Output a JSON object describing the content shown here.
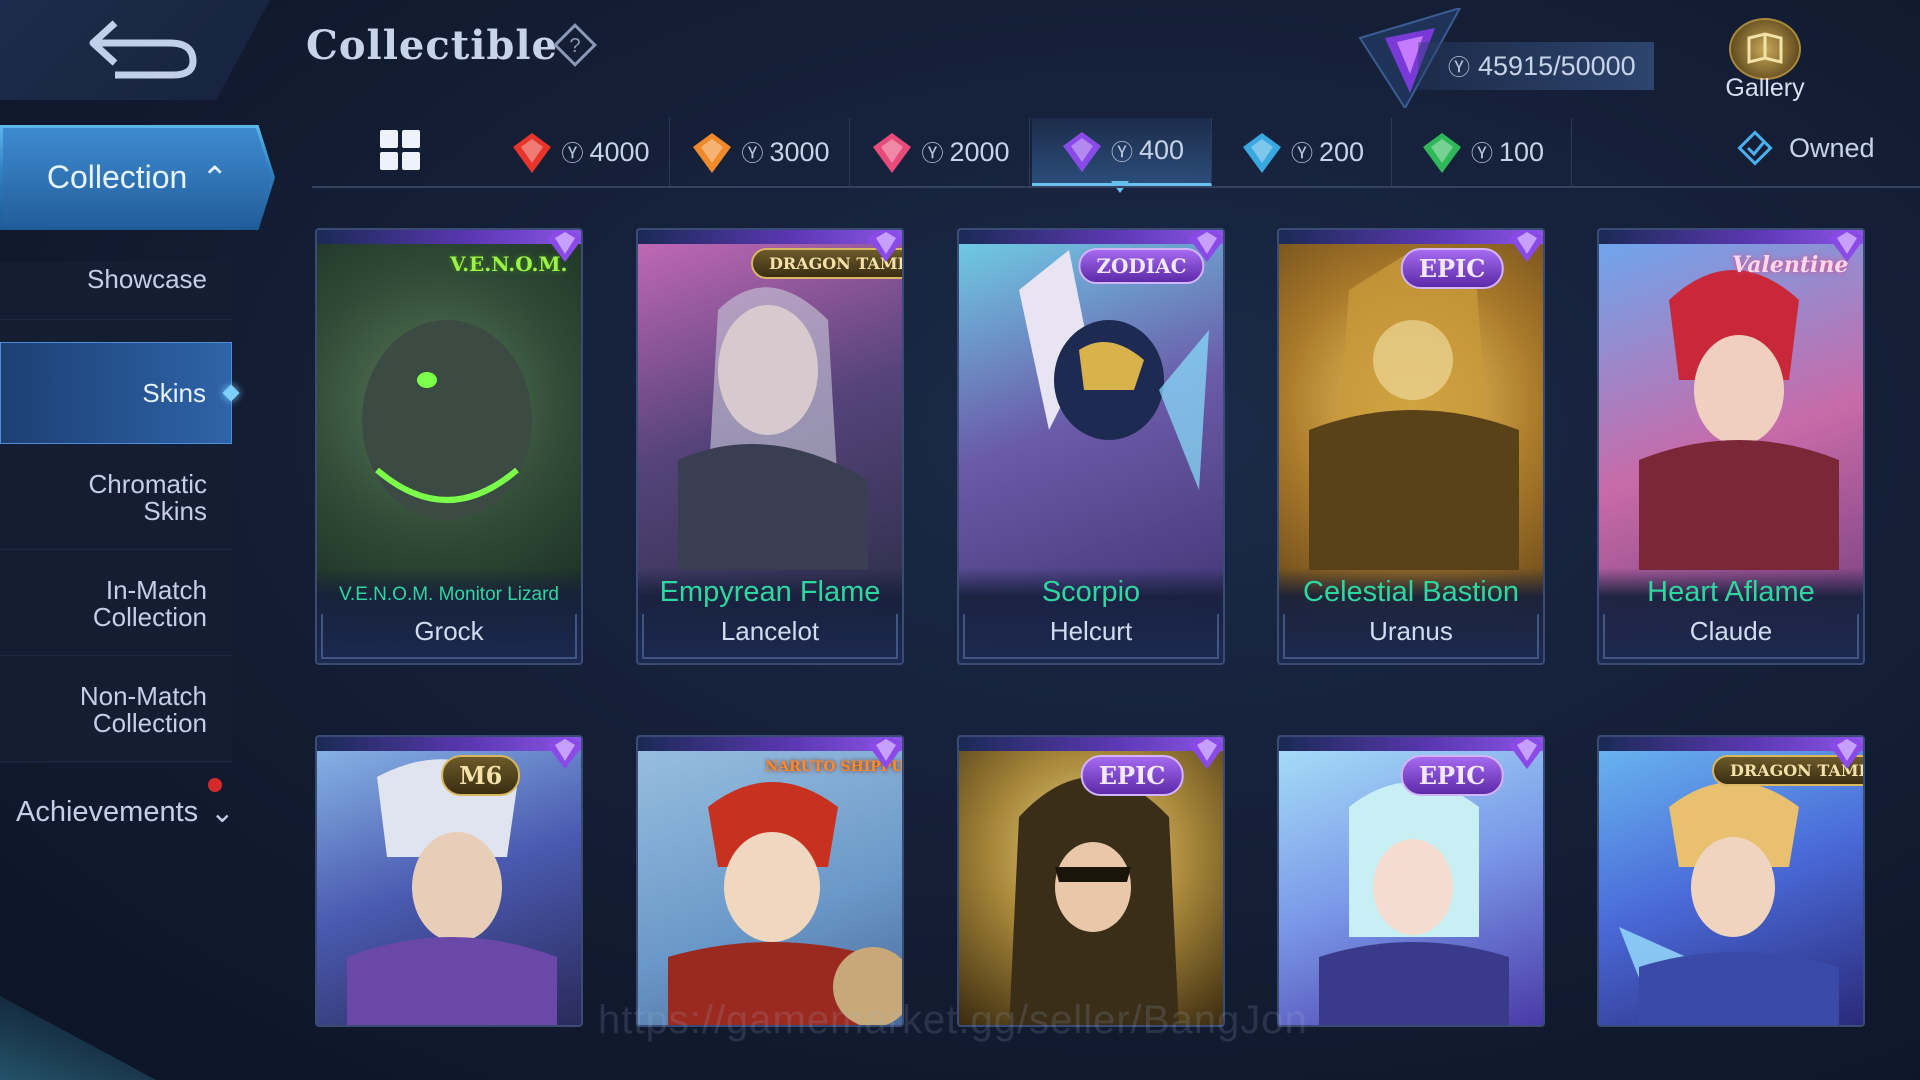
{
  "header": {
    "title": "Collectible",
    "currency": "45915/50000",
    "gallery_label": "Gallery"
  },
  "sidebar": {
    "collection_label": "Collection",
    "items": [
      {
        "label": "Showcase"
      },
      {
        "label": "Skins"
      },
      {
        "label": "Chromatic Skins"
      },
      {
        "label": "In-Match Collection"
      },
      {
        "label": "Non-Match Collection"
      }
    ],
    "achievements_label": "Achievements"
  },
  "tabs": [
    {
      "value": "4000",
      "gem_color": "#e8342a"
    },
    {
      "value": "3000",
      "gem_color": "#f08a2a"
    },
    {
      "value": "2000",
      "gem_color": "#e84a7a"
    },
    {
      "value": "400",
      "gem_color": "#8a4ae8"
    },
    {
      "value": "200",
      "gem_color": "#3aa8e0"
    },
    {
      "value": "100",
      "gem_color": "#2fb85a"
    }
  ],
  "owned_label": "Owned",
  "cards": [
    {
      "skin": "V.E.N.O.M. Monitor Lizard",
      "hero": "Grock",
      "badge": "V.E.N.O.M."
    },
    {
      "skin": "Empyrean Flame",
      "hero": "Lancelot",
      "badge": "DRAGON TAMER"
    },
    {
      "skin": "Scorpio",
      "hero": "Helcurt",
      "badge": "ZODIAC"
    },
    {
      "skin": "Celestial Bastion",
      "hero": "Uranus",
      "badge": "EPIC"
    },
    {
      "skin": "Heart Aflame",
      "hero": "Claude",
      "badge": "Valentine"
    },
    {
      "badge": "M6"
    },
    {
      "badge": "NARUTO SHIPPUDEN"
    },
    {
      "badge": "EPIC"
    },
    {
      "badge": "EPIC"
    },
    {
      "badge": "DRAGON TAMER"
    }
  ],
  "watermark": "https://gamemarket.gg/seller/BangJon",
  "colors": {
    "accent": "#68c0f0",
    "skin_name": "#2fd6a0",
    "active_tab_gem": "#8a4ae8"
  }
}
